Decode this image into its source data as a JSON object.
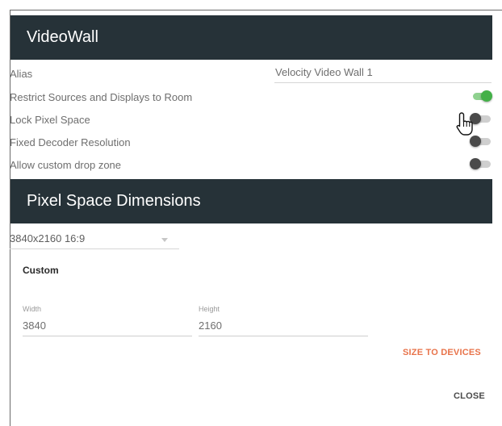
{
  "colors": {
    "header_bg": "#263238",
    "toggle_on": "#43b047",
    "accent": "#e8734a"
  },
  "videowall": {
    "title": "VideoWall",
    "alias_label": "Alias",
    "alias_value": "Velocity Video Wall 1",
    "restrict_label": "Restrict Sources and Displays to Room",
    "restrict_on": true,
    "lock_label": "Lock Pixel Space",
    "lock_on": false,
    "fixed_label": "Fixed Decoder Resolution",
    "fixed_on": false,
    "dropzone_label": "Allow custom drop zone",
    "dropzone_on": false
  },
  "pixel_space": {
    "title": "Pixel Space Dimensions",
    "selected_option": "3840x2160 16:9",
    "custom_title": "Custom",
    "width_label": "Width",
    "width_value": "3840",
    "height_label": "Height",
    "height_value": "2160",
    "size_to_devices_label": "SIZE TO DEVICES"
  },
  "footer": {
    "close_label": "CLOSE"
  },
  "icons": {
    "cursor": "hand-pointer-icon",
    "dropdown": "caret-down-icon"
  }
}
